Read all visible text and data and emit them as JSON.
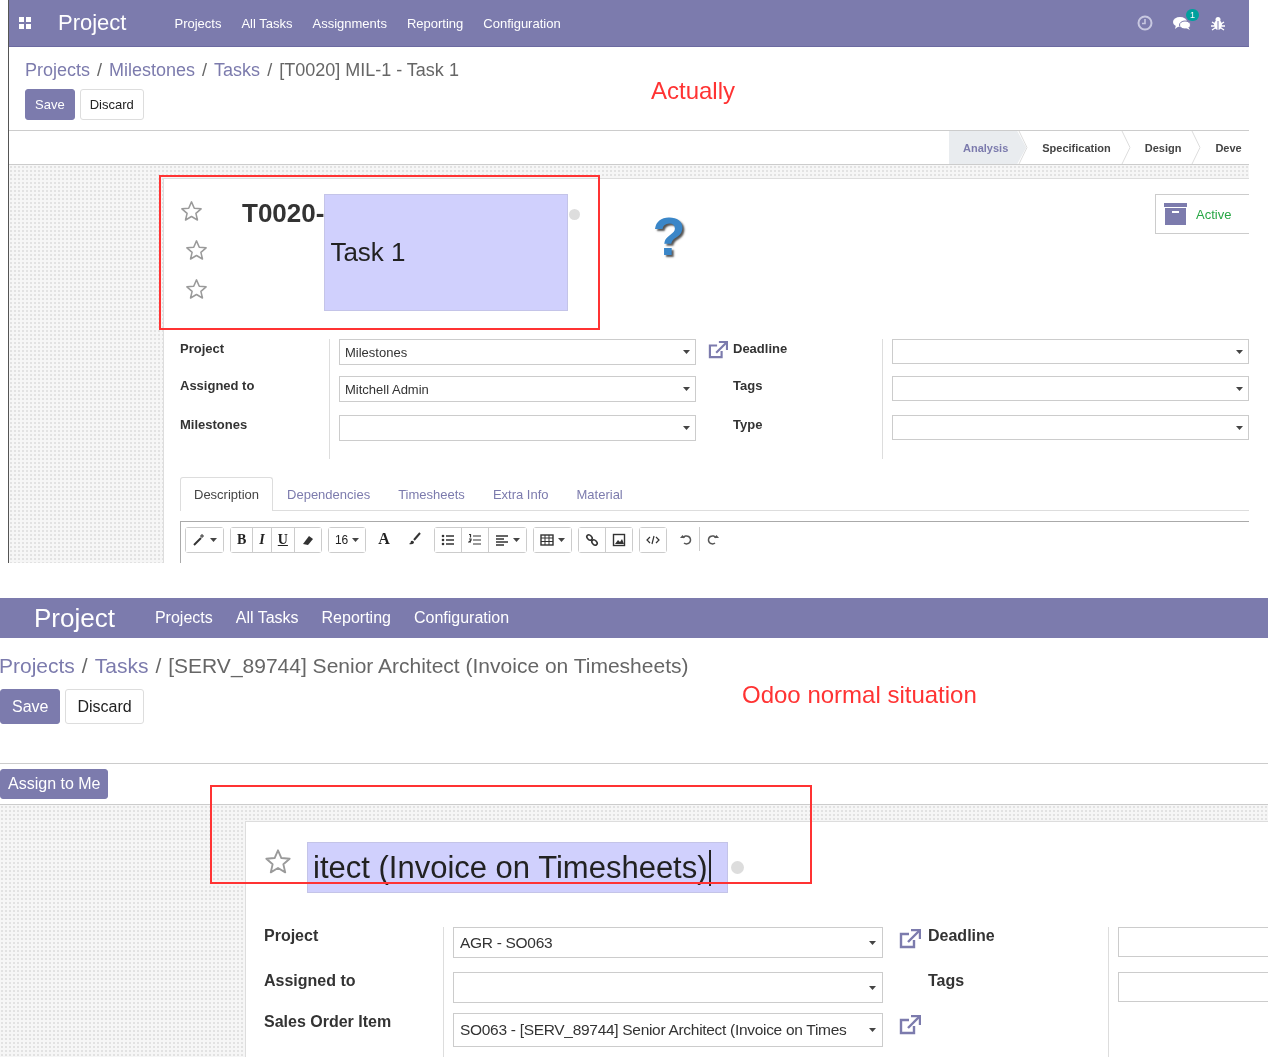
{
  "screens": [
    {
      "kind": "actual",
      "annotation": "Actually",
      "navbar": {
        "app": "Project",
        "menu": [
          "Projects",
          "All Tasks",
          "Assignments",
          "Reporting",
          "Configuration"
        ],
        "message_count": "1"
      },
      "breadcrumb": [
        {
          "label": "Projects",
          "kind": "link"
        },
        {
          "label": "/",
          "kind": "separator"
        },
        {
          "label": "Milestones",
          "kind": "link"
        },
        {
          "label": "/",
          "kind": "separator"
        },
        {
          "label": "Tasks",
          "kind": "link"
        },
        {
          "label": "/",
          "kind": "separator"
        },
        {
          "label": "[T0020] MIL-1 - Task 1",
          "kind": "current"
        }
      ],
      "buttons": [
        {
          "label": "Save",
          "kind": "save"
        },
        {
          "label": "Discard",
          "kind": "discard"
        }
      ],
      "stages": [
        {
          "label": "Analysis",
          "selected": true
        },
        {
          "label": "Specification",
          "selected": false
        },
        {
          "label": "Design",
          "selected": false
        },
        {
          "label": "Deve",
          "selected": false
        }
      ],
      "stars": [
        {
          "filled": false
        },
        {
          "filled": false
        },
        {
          "filled": false
        }
      ],
      "title": {
        "reference": "T0020-",
        "name": "Task 1"
      },
      "help_glyph": "?",
      "active_button": "Active",
      "fields": {
        "left": [
          {
            "label": "Project",
            "value": "Milestones",
            "kind": "select",
            "external_link": false
          },
          {
            "label": "Assigned to",
            "value": "Mitchell Admin",
            "kind": "select",
            "external_link": false
          },
          {
            "label": "Milestones",
            "kind": "select",
            "external_link": false
          }
        ],
        "right": [
          {
            "label": "Deadline",
            "kind": "select",
            "external_link": true
          },
          {
            "label": "Tags",
            "kind": "select",
            "external_link": false
          },
          {
            "label": "Type",
            "kind": "select",
            "external_link": false
          }
        ]
      },
      "tabs": [
        {
          "label": "Description",
          "selected": true
        },
        {
          "label": "Dependencies",
          "selected": false
        },
        {
          "label": "Timesheets",
          "selected": false
        },
        {
          "label": "Extra Info",
          "selected": false
        },
        {
          "label": "Material",
          "selected": false
        }
      ],
      "editor_toolbar": {
        "bold": "B",
        "italic": "I",
        "underline": "U",
        "font_size": "16",
        "font_color": "A"
      }
    },
    {
      "kind": "normal",
      "annotation": "Odoo normal situation",
      "navbar": {
        "app": "Project",
        "menu": [
          "Projects",
          "All Tasks",
          "Reporting",
          "Configuration"
        ]
      },
      "breadcrumb": [
        {
          "label": "Projects",
          "kind": "link"
        },
        {
          "label": "/",
          "kind": "separator"
        },
        {
          "label": "Tasks",
          "kind": "link"
        },
        {
          "label": "/",
          "kind": "separator"
        },
        {
          "label": "[SERV_89744] Senior Architect (Invoice on Timesheets)",
          "kind": "current"
        }
      ],
      "buttons": [
        {
          "label": "Save",
          "kind": "save"
        },
        {
          "label": "Discard",
          "kind": "discard"
        }
      ],
      "header_buttons": [
        {
          "label": "Assign to Me",
          "kind": "assign"
        }
      ],
      "stars": [
        {
          "filled": false
        }
      ],
      "title": {
        "name": "itect (Invoice on Timesheets)"
      },
      "fields": {
        "left": [
          {
            "label": "Project",
            "value": "AGR - SO063",
            "kind": "select",
            "external_link": false
          },
          {
            "label": "Assigned to",
            "kind": "select",
            "external_link": false
          },
          {
            "label": "Sales Order Item",
            "value": "SO063 - [SERV_89744] Senior Architect (Invoice on Times",
            "kind": "select",
            "external_link": true
          }
        ],
        "right": [
          {
            "label": "Deadline",
            "kind": "input",
            "external_link": true
          },
          {
            "label": "Tags",
            "kind": "input",
            "external_link": false
          }
        ]
      }
    }
  ]
}
